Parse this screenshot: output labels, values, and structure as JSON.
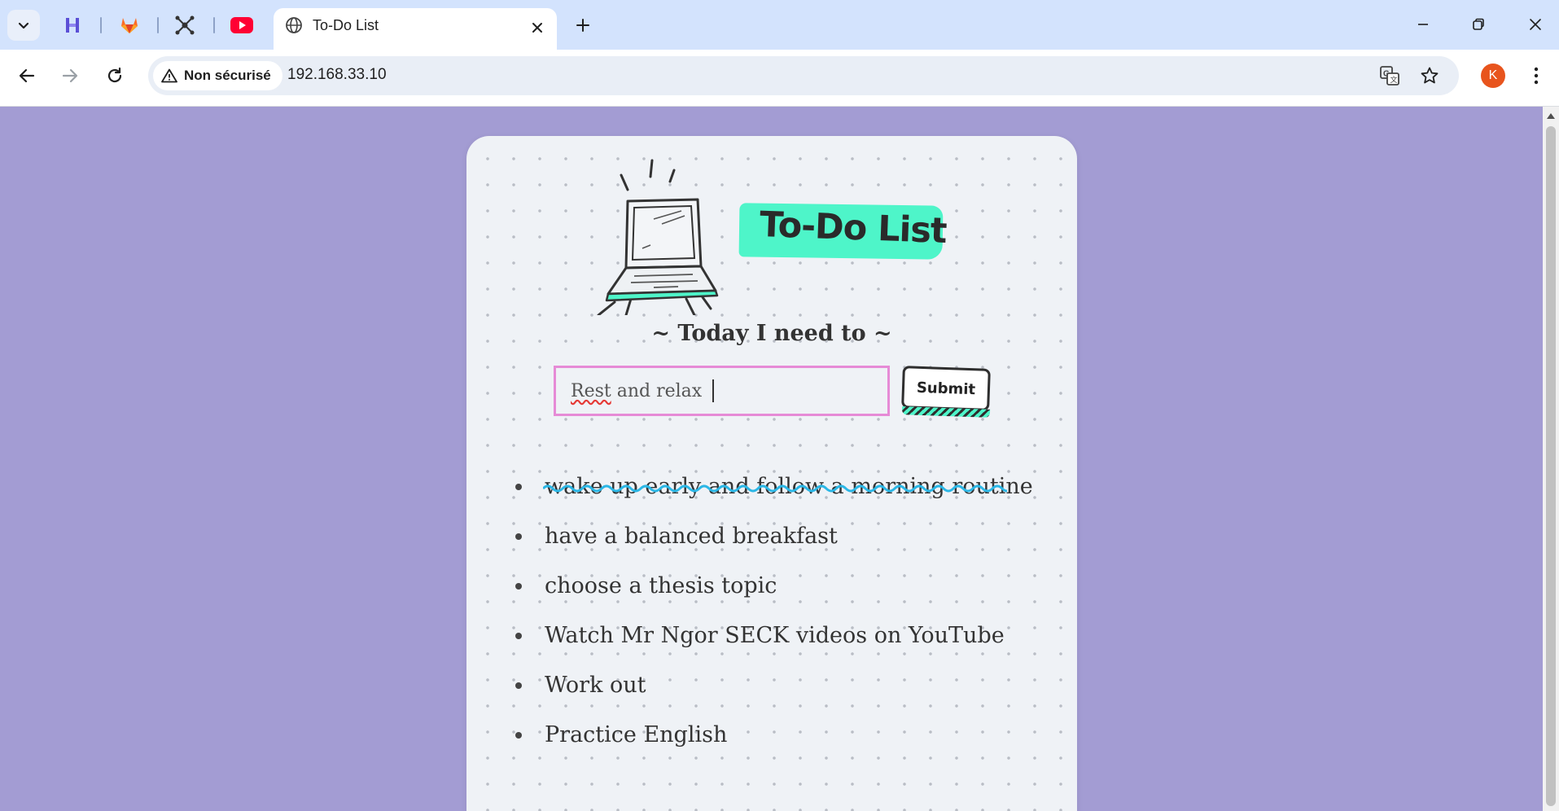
{
  "browser": {
    "tabs": [
      {
        "title": "To-Do List",
        "active": true
      }
    ],
    "pinned_icons": [
      "hotel-icon",
      "gitlab-icon",
      "network-icon",
      "youtube-icon"
    ],
    "security_label": "Non sécurisé",
    "url": "192.168.33.10",
    "profile_initial": "K"
  },
  "app": {
    "title": "To-Do List",
    "subtitle": "~ Today I need to ~",
    "input": {
      "value_misspelled": "Rest",
      "value_rest": " and relax "
    },
    "submit_label": "Submit",
    "items": [
      {
        "text": "wake up early and follow a morning routine",
        "done": true
      },
      {
        "text": "have a balanced breakfast",
        "done": false
      },
      {
        "text": "choose a thesis topic",
        "done": false
      },
      {
        "text": "Watch Mr Ngor SECK videos on YouTube",
        "done": false
      },
      {
        "text": "Work out",
        "done": false
      },
      {
        "text": "Practice English",
        "done": false
      }
    ]
  },
  "colors": {
    "page_bg": "#a39cd3",
    "card_bg": "#eff2f6",
    "accent_green": "#4ef5c9",
    "input_border": "#e68bd6",
    "strike_blue": "#2bb7e6"
  }
}
